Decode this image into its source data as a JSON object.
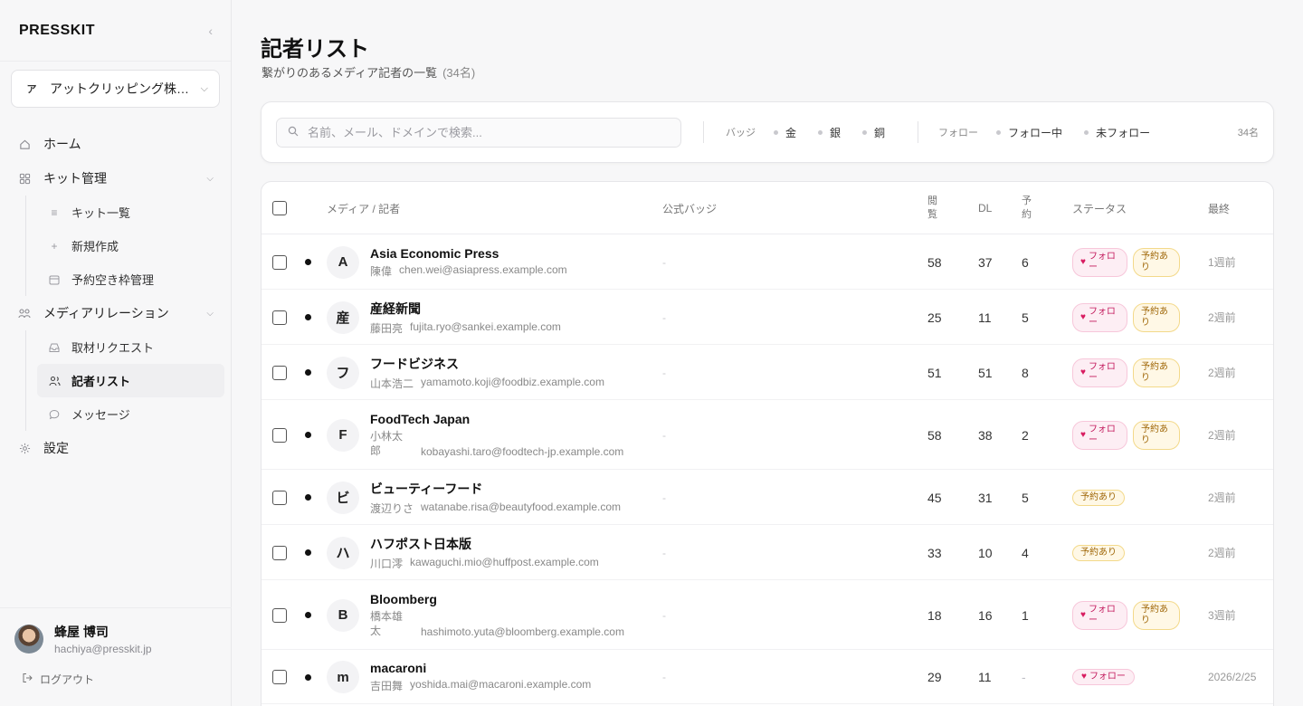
{
  "app": {
    "brand": "PRESSKIT",
    "collapse_icon": "chevron-left-icon"
  },
  "org": {
    "initial": "ア",
    "name": "アットクリッピング株式会社"
  },
  "nav": {
    "home": "ホーム",
    "kit": "キット管理",
    "kit_list": "キット一覧",
    "kit_new": "新規作成",
    "kit_slots": "予約空き枠管理",
    "media": "メディアリレーション",
    "requests": "取材リクエスト",
    "reporters": "記者リスト",
    "messages": "メッセージ",
    "settings": "設定"
  },
  "user": {
    "name": "蜂屋 博司",
    "email": "hachiya@presskit.jp",
    "logout": "ログアウト"
  },
  "page": {
    "title": "記者リスト",
    "subtitle": "繋がりのあるメディア記者の一覧",
    "count": "(34名)"
  },
  "filter": {
    "search_placeholder": "名前、メール、ドメインで検索...",
    "badge_label": "バッジ",
    "badges": [
      "金",
      "銀",
      "銅"
    ],
    "follow_label": "フォロー",
    "follows": [
      "フォロー中",
      "未フォロー"
    ],
    "count": "34名"
  },
  "table": {
    "headers": {
      "media": "メディア / 記者",
      "badge": "公式バッジ",
      "views": "閲覧",
      "dl": "DL",
      "resv": "予約",
      "status": "ステータス",
      "last": "最終"
    },
    "follow_label": "フォロー",
    "resv_label": "予約あり",
    "rows": [
      {
        "initial": "A",
        "media": "Asia Economic Press",
        "reporter": "陳偉",
        "email": "chen.wei@asiapress.example.com",
        "badge": "-",
        "views": "58",
        "dl": "37",
        "resv": "6",
        "last": "1週前"
      },
      {
        "initial": "産",
        "media": "産経新聞",
        "reporter": "藤田亮",
        "email": "fujita.ryo@sankei.example.com",
        "badge": "-",
        "views": "25",
        "dl": "11",
        "resv": "5",
        "last": "2週前"
      },
      {
        "initial": "フ",
        "media": "フードビジネス",
        "reporter": "山本浩二",
        "email": "yamamoto.koji@foodbiz.example.com",
        "badge": "-",
        "views": "51",
        "dl": "51",
        "resv": "8",
        "last": "2週前"
      },
      {
        "initial": "F",
        "media": "FoodTech Japan",
        "reporter": "小林太郎",
        "email": "kobayashi.taro@foodtech-jp.example.com",
        "badge": "-",
        "views": "58",
        "dl": "38",
        "resv": "2",
        "last": "2週前"
      },
      {
        "initial": "ビ",
        "media": "ビューティーフード",
        "reporter": "渡辺りさ",
        "email": "watanabe.risa@beautyfood.example.com",
        "badge": "-",
        "views": "45",
        "dl": "31",
        "resv": "5",
        "last": "2週前"
      },
      {
        "initial": "ハ",
        "media": "ハフポスト日本版",
        "reporter": "川口澪",
        "email": "kawaguchi.mio@huffpost.example.com",
        "badge": "-",
        "views": "33",
        "dl": "10",
        "resv": "4",
        "last": "2週前"
      },
      {
        "initial": "B",
        "media": "Bloomberg",
        "reporter": "橋本雄太",
        "email": "hashimoto.yuta@bloomberg.example.com",
        "badge": "-",
        "views": "18",
        "dl": "16",
        "resv": "1",
        "last": "3週前"
      },
      {
        "initial": "m",
        "media": "macaroni",
        "reporter": "吉田舞",
        "email": "yoshida.mai@macaroni.example.com",
        "badge": "-",
        "views": "29",
        "dl": "11",
        "resv": "-",
        "last": "2026/2/25"
      }
    ]
  }
}
